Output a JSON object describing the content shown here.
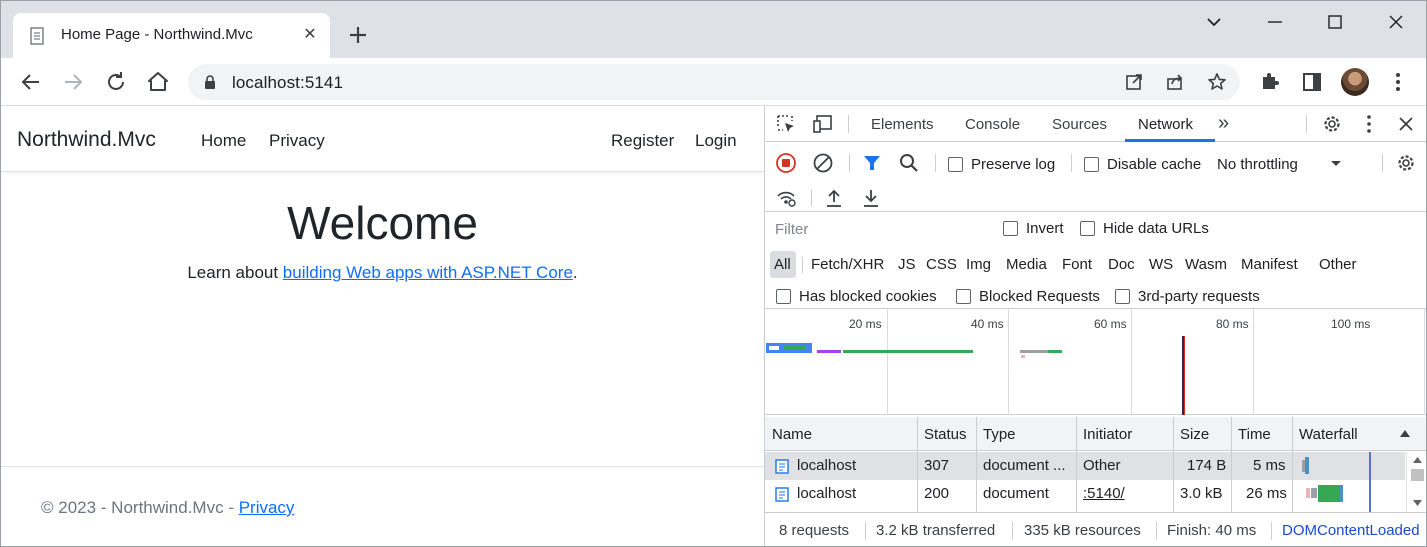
{
  "browser": {
    "tab_title": "Home Page - Northwind.Mvc",
    "url": "localhost:5141"
  },
  "site": {
    "brand": "Northwind.Mvc",
    "nav": [
      "Home",
      "Privacy"
    ],
    "nav_right": [
      "Register",
      "Login"
    ],
    "heading": "Welcome",
    "lead_prefix": "Learn about ",
    "lead_link": "building Web apps with ASP.NET Core",
    "lead_suffix": ".",
    "footer_text": "© 2023 - Northwind.Mvc - ",
    "footer_link": "Privacy"
  },
  "devtools": {
    "tabs": [
      "Elements",
      "Console",
      "Sources",
      "Network"
    ],
    "active_tab": "Network",
    "more_tabs": "»",
    "preserve_log": "Preserve log",
    "disable_cache": "Disable cache",
    "throttling": "No throttling",
    "filter_placeholder": "Filter",
    "invert": "Invert",
    "hide_data_urls": "Hide data URLs",
    "types": [
      "All",
      "Fetch/XHR",
      "JS",
      "CSS",
      "Img",
      "Media",
      "Font",
      "Doc",
      "WS",
      "Wasm",
      "Manifest",
      "Other"
    ],
    "blocked_cookies": "Has blocked cookies",
    "blocked_requests": "Blocked Requests",
    "third_party": "3rd-party requests",
    "timeline_labels": [
      "20 ms",
      "40 ms",
      "60 ms",
      "80 ms",
      "100 ms"
    ],
    "columns": [
      "Name",
      "Status",
      "Type",
      "Initiator",
      "Size",
      "Time",
      "Waterfall"
    ],
    "rows": [
      {
        "name": "localhost",
        "status": "307",
        "type": "document ...",
        "initiator": "Other",
        "size": "174 B",
        "time": "5 ms"
      },
      {
        "name": "localhost",
        "status": "200",
        "type": "document",
        "initiator": ":5140/",
        "size": "3.0 kB",
        "time": "26 ms"
      }
    ],
    "status": {
      "requests": "8 requests",
      "transferred": "3.2 kB transferred",
      "resources": "335 kB resources",
      "finish": "Finish: 40 ms",
      "dcl": "DOMContentLoaded"
    }
  },
  "colors": {
    "link": "#0d6efd",
    "devtools_accent": "#1a73e8",
    "record_red": "#d93025"
  }
}
